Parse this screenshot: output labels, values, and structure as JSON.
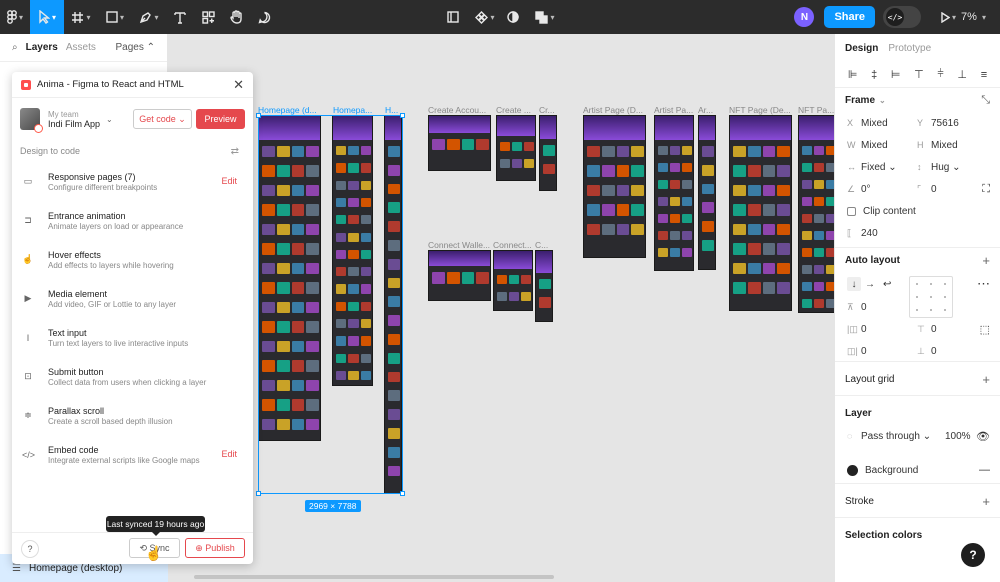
{
  "toolbar": {
    "share_label": "Share",
    "user_initial": "N",
    "zoom": "7%",
    "dev_mode_label": "</>"
  },
  "left_panel": {
    "tabs": [
      "Layers",
      "Assets"
    ],
    "pages_label": "Pages",
    "selected_frame": "Homepage (desktop)"
  },
  "plugin": {
    "title": "Anima - Figma to React and HTML",
    "team_label": "My team",
    "team_name": "Indi Film App",
    "get_code": "Get code",
    "preview": "Preview",
    "section_title": "Design to code",
    "features": [
      {
        "title": "Responsive pages (7)",
        "desc": "Configure different breakpoints",
        "icon": "▭",
        "edit": "Edit"
      },
      {
        "title": "Entrance animation",
        "desc": "Animate layers on load or appearance",
        "icon": "⊐",
        "edit": ""
      },
      {
        "title": "Hover effects",
        "desc": "Add effects to layers while hovering",
        "icon": "☝",
        "edit": ""
      },
      {
        "title": "Media element",
        "desc": "Add video, GIF or Lottie to any layer",
        "icon": "▶",
        "edit": ""
      },
      {
        "title": "Text input",
        "desc": "Turn text layers to live interactive inputs",
        "icon": "I",
        "edit": ""
      },
      {
        "title": "Submit button",
        "desc": "Collect data from users when clicking a layer",
        "icon": "⊡",
        "edit": ""
      },
      {
        "title": "Parallax scroll",
        "desc": "Create a scroll based depth illusion",
        "icon": "≑",
        "edit": ""
      },
      {
        "title": "Embed code",
        "desc": "Integrate external scripts like Google maps",
        "icon": "</>",
        "edit": "Edit"
      }
    ],
    "help": "?",
    "sync": "Sync",
    "publish": "Publish",
    "tooltip": "Last synced 19 hours ago"
  },
  "canvas": {
    "frame_labels": [
      "Homepage (d...",
      "Homepa...",
      "H...",
      "Create Accou...",
      "Create ...",
      "Cr...",
      "Artist Page (D...",
      "Artist Pa...",
      "Ar...",
      "NFT Page (De...",
      "NFT Pa...",
      "Connect Walle...",
      "Connect...",
      "C..."
    ],
    "selection_size": "2969 × 7788"
  },
  "right_panel": {
    "tabs": [
      "Design",
      "Prototype"
    ],
    "frame_title": "Frame",
    "x_label": "X",
    "x_value": "Mixed",
    "y_label": "Y",
    "y_value": "75616",
    "w_label": "W",
    "w_value": "Mixed",
    "h_label": "H",
    "h_value": "Mixed",
    "horiz_resize": "Fixed",
    "vert_resize": "Hug",
    "rotation": "0°",
    "radius": "0",
    "clip_content": "Clip content",
    "other_value": "240",
    "auto_layout_title": "Auto layout",
    "gap_value": "0",
    "pad_left": "0",
    "pad_top": "0",
    "pad_right": "0",
    "pad_bottom": "0",
    "layout_grid_title": "Layout grid",
    "layer_title": "Layer",
    "blend_mode": "Pass through",
    "opacity": "100%",
    "background_label": "Background",
    "stroke_title": "Stroke",
    "selection_colors_title": "Selection colors",
    "help": "?"
  },
  "colors": {
    "accent": "#0d99ff",
    "anima_red": "#e5484d",
    "toolbar_bg": "#2c2c2c",
    "frame_purple": "#8a4bd8"
  }
}
